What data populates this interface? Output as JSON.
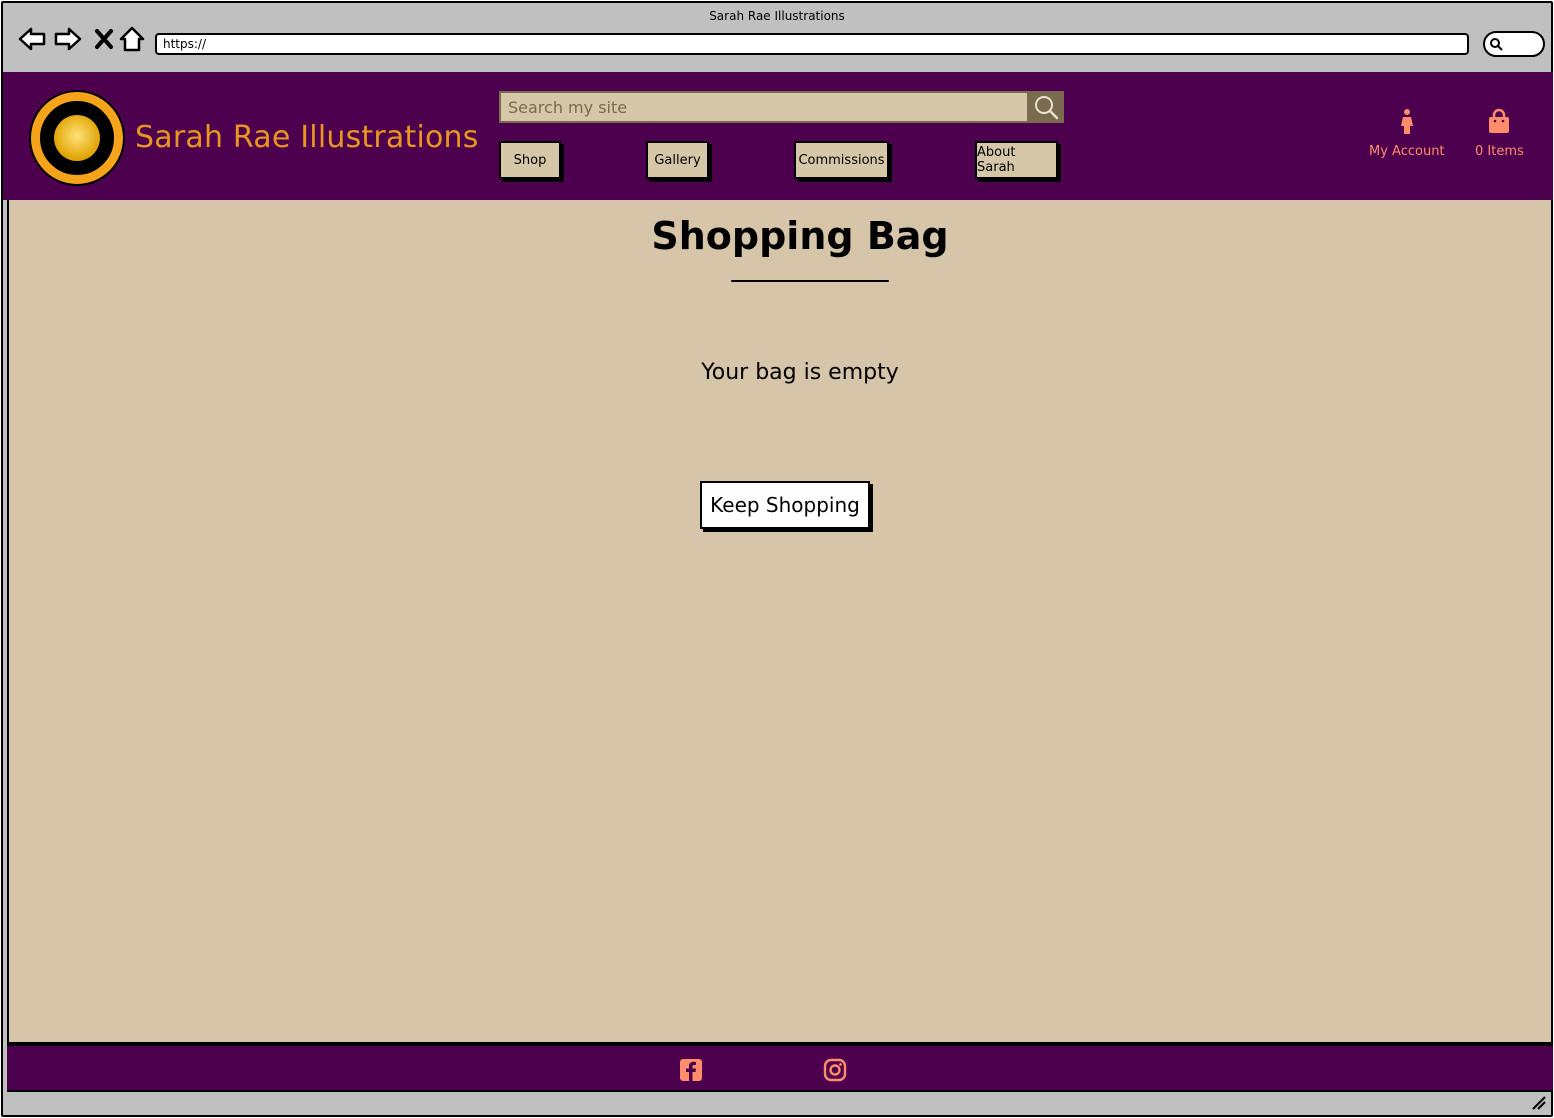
{
  "browser": {
    "window_title": "Sarah Rae Illustrations",
    "url": "https://",
    "icons": [
      "back-arrow-icon",
      "forward-arrow-icon",
      "close-x-icon",
      "home-icon",
      "search-icon"
    ]
  },
  "header": {
    "site_name": "Sarah Rae Illustrations",
    "logo": "Sarah Rae Illustrations circular logo",
    "search": {
      "placeholder": "Search my site",
      "value": ""
    },
    "nav": [
      {
        "label": "Shop"
      },
      {
        "label": "Gallery"
      },
      {
        "label": "Commissions"
      },
      {
        "label": "About Sarah"
      }
    ],
    "account_label": "My Account",
    "bag_label": "0 Items"
  },
  "main": {
    "title": "Shopping Bag",
    "empty_message": "Your bag is empty",
    "keep_shopping_label": "Keep Shopping"
  },
  "footer": {
    "social": [
      "facebook-icon",
      "instagram-icon"
    ]
  },
  "colors": {
    "header_bg": "#4d004d",
    "brand_text": "#e8961f",
    "accent_icon": "#ff8c6b",
    "main_bg": "#d6c5a9",
    "nav_button_bg": "#d6c7a8"
  }
}
